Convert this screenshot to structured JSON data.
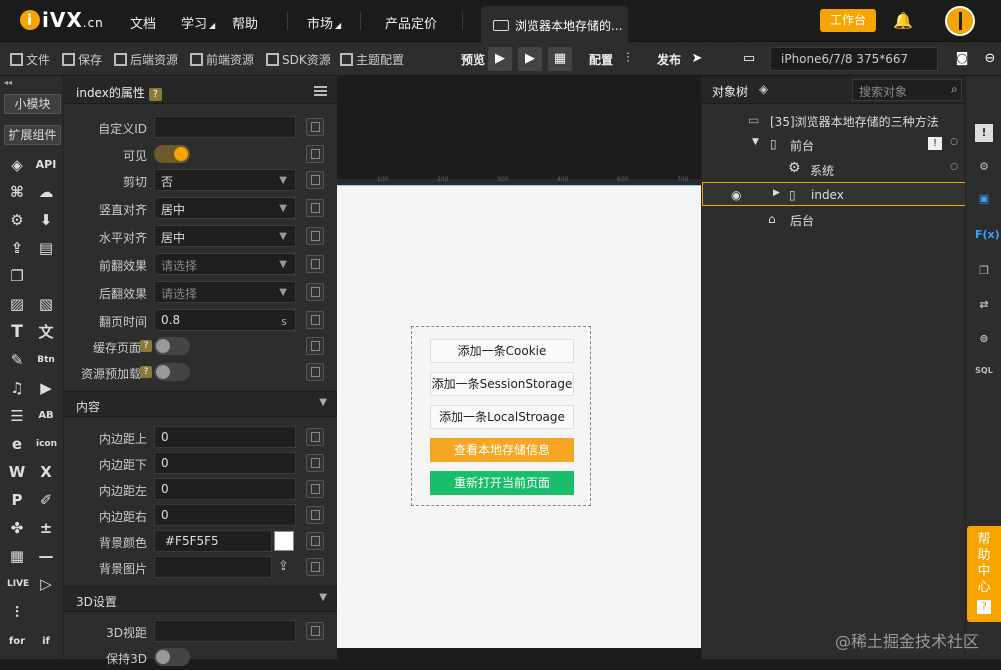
{
  "brand": {
    "logo": "iVX",
    "logo_suffix": ".cn",
    "accent": "#f5a400"
  },
  "topnav": {
    "items": [
      "文档",
      "学习",
      "帮助",
      "市场",
      "产品定价"
    ],
    "tab_title": "浏览器本地存储的...",
    "workbench": "工作台"
  },
  "toolbar": {
    "left": [
      "文件",
      "保存",
      "后端资源",
      "前端资源",
      "SDK资源",
      "主题配置"
    ],
    "preview": "预览",
    "config": "配置",
    "publish": "发布",
    "device": "iPhone6/7/8 375*667"
  },
  "iconcol": {
    "tab1": "小模块",
    "tab2": "扩展组件",
    "api": "API"
  },
  "props": {
    "title": "index的属性",
    "rows": [
      {
        "label": "自定义ID",
        "value": ""
      },
      {
        "label": "可见"
      },
      {
        "label": "剪切",
        "value": "否"
      },
      {
        "label": "竖直对齐",
        "value": "居中"
      },
      {
        "label": "水平对齐",
        "value": "居中"
      },
      {
        "label": "前翻效果",
        "value": "请选择"
      },
      {
        "label": "后翻效果",
        "value": "请选择"
      },
      {
        "label": "翻页时间",
        "value": "0.8",
        "unit": "s"
      },
      {
        "label": "缓存页面"
      },
      {
        "label": "资源预加载"
      }
    ],
    "section_content": "内容",
    "content_rows": [
      {
        "label": "内边距上",
        "value": "0"
      },
      {
        "label": "内边距下",
        "value": "0"
      },
      {
        "label": "内边距左",
        "value": "0"
      },
      {
        "label": "内边距右",
        "value": "0"
      },
      {
        "label": "背景颜色",
        "value": "#F5F5F5"
      },
      {
        "label": "背景图片",
        "value": ""
      }
    ],
    "section_3d": "3D设置",
    "rows_3d": [
      {
        "label": "3D视距",
        "value": ""
      },
      {
        "label": "保持3D"
      }
    ]
  },
  "canvas": {
    "buttons": [
      "添加一条Cookie",
      "添加一条SessionStorage",
      "添加一条LocalStroage",
      "查看本地存储信息",
      "重新打开当前页面"
    ],
    "ruler": [
      "100",
      "200",
      "300",
      "400",
      "500",
      "600",
      "700"
    ]
  },
  "tree": {
    "title": "对象树",
    "search_placeholder": "搜索对象",
    "nodes": [
      "[35]浏览器本地存储的三种方法",
      "前台",
      "系统",
      "index",
      "后台"
    ]
  },
  "rail": {
    "fx": "F(x)",
    "sql": "SQL"
  },
  "help": {
    "text": "帮助中心"
  },
  "watermark": "@稀土掘金技术社区"
}
